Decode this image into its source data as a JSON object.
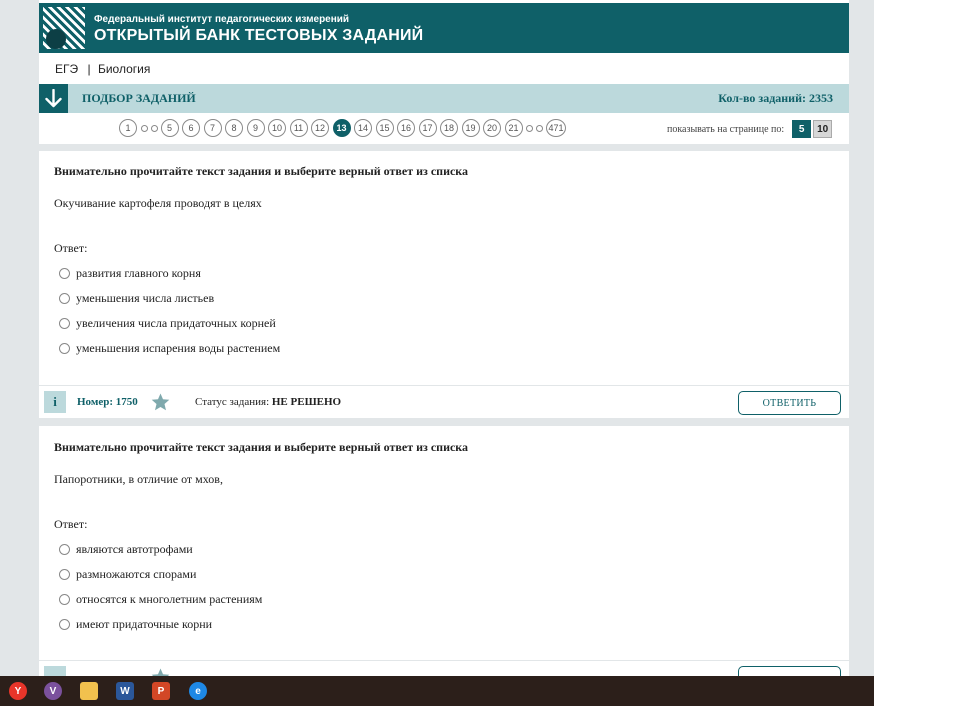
{
  "header": {
    "org": "Федеральный институт педагогических измерений",
    "bank": "ОТКРЫТЫЙ БАНК ТЕСТОВЫХ ЗАДАНИЙ"
  },
  "breadcrumb": {
    "exam": "ЕГЭ",
    "separator": "|",
    "subject": "Биология"
  },
  "selection_bar": {
    "title": "ПОДБОР ЗАДАНИЙ",
    "count": "Кол-во заданий: 2353"
  },
  "pagination": {
    "pages": [
      "1",
      "5",
      "6",
      "7",
      "8",
      "9",
      "10",
      "11",
      "12",
      "13",
      "14",
      "15",
      "16",
      "17",
      "18",
      "19",
      "20",
      "21",
      "471"
    ],
    "active": "13",
    "per_page_label": "показывать на странице по:",
    "per_page_options": [
      "5",
      "10"
    ],
    "per_page_selected": "5"
  },
  "tasks": [
    {
      "instruction": "Внимательно прочитайте текст задания и выберите верный ответ из списка",
      "question": "Окучивание картофеля проводят в целях",
      "answer_label": "Ответ:",
      "options": [
        "развития главного корня",
        "уменьшения числа листьев",
        "увеличения числа придаточных корней",
        "уменьшения испарения воды растением"
      ],
      "info": "i",
      "number": "Номер: 1750",
      "status_label": "Статус задания:",
      "status_value": "НЕ РЕШЕНО",
      "answer_button": "ОТВЕТИТЬ"
    },
    {
      "instruction": "Внимательно прочитайте текст задания и выберите верный ответ из списка",
      "question": "Папоротники, в отличие от мхов,",
      "answer_label": "Ответ:",
      "options": [
        "являются автотрофами",
        "размножаются спорами",
        "относятся к многолетним растениям",
        "имеют придаточные корни"
      ]
    }
  ],
  "taskbar": {
    "apps": [
      {
        "icon": "yandex-browser-icon",
        "glyph": "Y",
        "color": "#e8352a"
      },
      {
        "icon": "viber-icon",
        "glyph": "V",
        "color": "#7b519d"
      },
      {
        "icon": "file-explorer-icon",
        "glyph": "",
        "color": "#f2c14e"
      },
      {
        "icon": "word-icon",
        "glyph": "W",
        "color": "#2b579a"
      },
      {
        "icon": "powerpoint-icon",
        "glyph": "P",
        "color": "#d24726"
      },
      {
        "icon": "edge-legacy-icon",
        "glyph": "e",
        "color": "#1e88e5"
      }
    ]
  },
  "colors": {
    "brand": "#0f6068",
    "bar": "#bcd9dc",
    "background": "#e2e6e8",
    "taskbar": "#2c1f1a"
  }
}
